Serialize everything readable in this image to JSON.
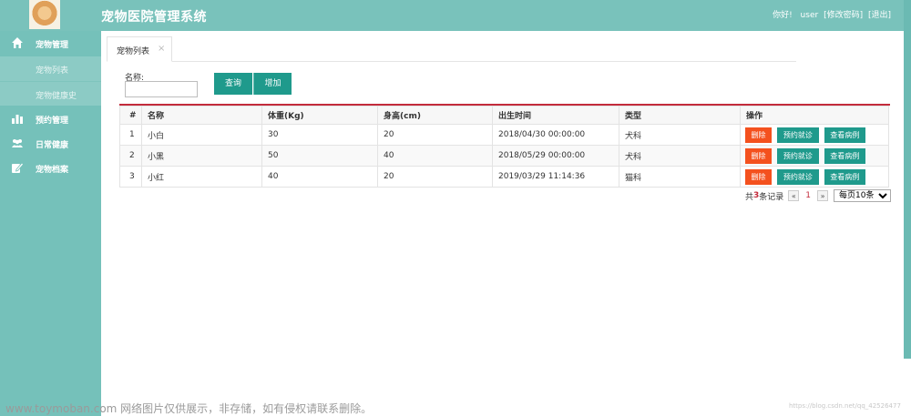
{
  "header": {
    "title": "宠物医院管理系统",
    "greeting": "你好!",
    "username": "user",
    "change_password": "[修改密码]",
    "logout": "[退出]"
  },
  "sidebar": {
    "items": [
      {
        "label": "宠物管理",
        "icon": "home-icon"
      },
      {
        "label": "宠物列表"
      },
      {
        "label": "宠物健康史"
      },
      {
        "label": "预约管理",
        "icon": "bar-chart-icon"
      },
      {
        "label": "日常健康",
        "icon": "users-icon"
      },
      {
        "label": "宠物档案",
        "icon": "edit-icon"
      }
    ]
  },
  "tabs": [
    {
      "label": "宠物列表",
      "close": "×"
    }
  ],
  "search": {
    "name_label": "名称:",
    "name_value": "",
    "query_button": "查询",
    "add_button": "增加"
  },
  "table": {
    "headers": [
      "#",
      "名称",
      "体重(Kg)",
      "身高(cm)",
      "出生时间",
      "类型",
      "操作"
    ],
    "rows": [
      [
        "1",
        "小白",
        "30",
        "20",
        "2018/04/30 00:00:00",
        "犬科"
      ],
      [
        "2",
        "小黑",
        "50",
        "40",
        "2018/05/29 00:00:00",
        "犬科"
      ],
      [
        "3",
        "小红",
        "40",
        "20",
        "2019/03/29 11:14:36",
        "猫科"
      ]
    ],
    "actions": {
      "delete": "删除",
      "appointment": "预约就诊",
      "view_cases": "查看病例"
    }
  },
  "pagination": {
    "total_prefix": "共",
    "total_count": "3",
    "total_suffix": "条记录",
    "prev": "«",
    "current_page": "1",
    "next": "»",
    "page_size": "每页10条"
  },
  "watermark": {
    "left": "www.toymoban.com 网络图片仅供展示，非存储，如有侵权请联系删除。",
    "right": "https://blog.csdn.net/qq_42526477"
  },
  "colors": {
    "header_bg": "#79c2bb",
    "sidebar_bg": "#75c1ba",
    "primary_button": "#1f9a8c",
    "danger_button": "#f4511e",
    "table_accent": "#c32b3b"
  }
}
